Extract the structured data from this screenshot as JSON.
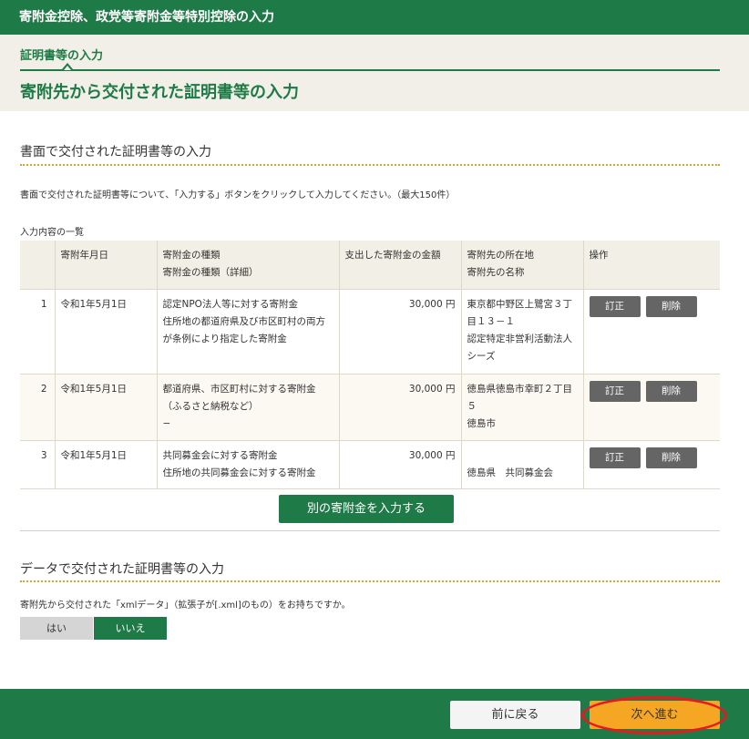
{
  "header": {
    "title": "寄附金控除、政党等寄附金等特別控除の入力"
  },
  "step": {
    "label": "証明書等の入力",
    "title": "寄附先から交付された証明書等の入力"
  },
  "paper_section": {
    "title": "書面で交付された証明書等の入力",
    "description": "書面で交付された証明書等について、「入力する」ボタンをクリックして入力してください。（最大150件）",
    "list_caption": "入力内容の一覧"
  },
  "table": {
    "headers": {
      "date": "寄附年月日",
      "type_1": "寄附金の種類",
      "type_2": "寄附金の種類（詳細）",
      "amount": "支出した寄附金の金額",
      "place_1": "寄附先の所在地",
      "place_2": "寄附先の名称",
      "ops": "操作"
    },
    "rows": [
      {
        "no": "1",
        "date": "令和1年5月1日",
        "type": "認定NPO法人等に対する寄附金",
        "type_detail": "住所地の都道府県及び市区町村の両方が条例により指定した寄附金",
        "amount": "30,000 円",
        "address": "東京都中野区上鷺宮３丁目１３－１",
        "name": "認定特定非営利活動法人シーズ",
        "edit": "訂正",
        "delete": "削除"
      },
      {
        "no": "2",
        "date": "令和1年5月1日",
        "type": "都道府県、市区町村に対する寄附金（ふるさと納税など）",
        "type_detail": "−",
        "amount": "30,000 円",
        "address": "徳島県徳島市幸町２丁目５",
        "name": "徳島市",
        "edit": "訂正",
        "delete": "削除"
      },
      {
        "no": "3",
        "date": "令和1年5月1日",
        "type": "共同募金会に対する寄附金",
        "type_detail": "住所地の共同募金会に対する寄附金",
        "amount": "30,000 円",
        "address": "",
        "name": "徳島県　共同募金会",
        "edit": "訂正",
        "delete": "削除"
      }
    ]
  },
  "add_button": "別の寄附金を入力する",
  "data_section": {
    "title": "データで交付された証明書等の入力",
    "question": "寄附先から交付された「xmlデータ」（拡張子が[.xml]のもの）をお持ちですか。",
    "yes": "はい",
    "no": "いいえ",
    "selected": "いいえ"
  },
  "footer": {
    "back": "前に戻る",
    "next": "次へ進む"
  },
  "colors": {
    "brand": "#1e7a46",
    "accent": "#f5a623",
    "highlight": "#e8191e"
  }
}
